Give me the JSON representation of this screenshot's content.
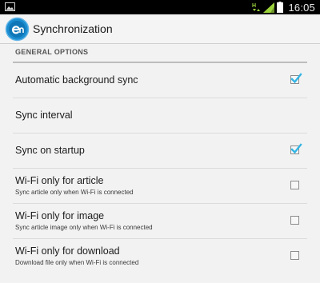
{
  "status_bar": {
    "time": "16:05",
    "icons": [
      "gallery-icon",
      "hspa-data-icon",
      "signal-icon",
      "battery-icon"
    ]
  },
  "action_bar": {
    "logo_icon": "app-logo-icon",
    "title": "Synchronization"
  },
  "settings": {
    "section_title": "GENERAL OPTIONS",
    "items": [
      {
        "title": "Automatic background sync",
        "summary": "",
        "checked": true
      },
      {
        "title": "Sync interval",
        "summary": ""
      },
      {
        "title": "Sync on startup",
        "summary": "",
        "checked": true
      },
      {
        "title": "Wi-Fi only for article",
        "summary": "Sync article only when Wi-Fi is connected",
        "checked": false
      },
      {
        "title": "Wi-Fi only for image",
        "summary": "Sync article image only when Wi-Fi is connected",
        "checked": false
      },
      {
        "title": "Wi-Fi only for download",
        "summary": "Download file only when Wi-Fi is connected",
        "checked": false
      }
    ]
  },
  "colors": {
    "checkmark": "#33b5e5",
    "status_bar": "#000000",
    "logo_blue": "#1b8ed1"
  }
}
